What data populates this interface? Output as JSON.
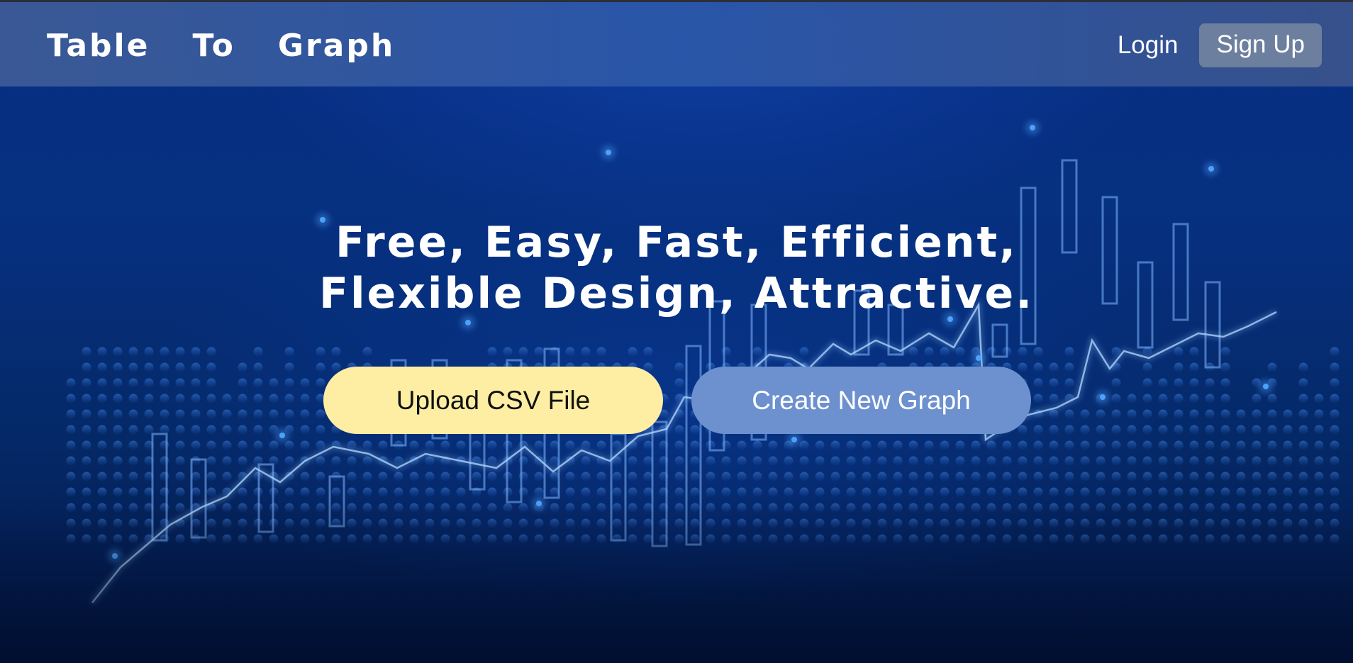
{
  "navbar": {
    "brand_words": [
      "Table",
      "To",
      "Graph"
    ],
    "login_label": "Login",
    "signup_label": "Sign Up"
  },
  "hero": {
    "title_line1": "Free, Easy, Fast, Efficient,",
    "title_line2": "Flexible Design, Attractive.",
    "upload_button": "Upload CSV File",
    "create_button": "Create New Graph"
  },
  "colors": {
    "background": "#062f80",
    "navbar": "#3a5a98",
    "upload_button": "#fdeea4",
    "create_button": "#6d91cf",
    "signup_button": "#6d7f9e",
    "chart_glow": "#4fa6ff"
  }
}
